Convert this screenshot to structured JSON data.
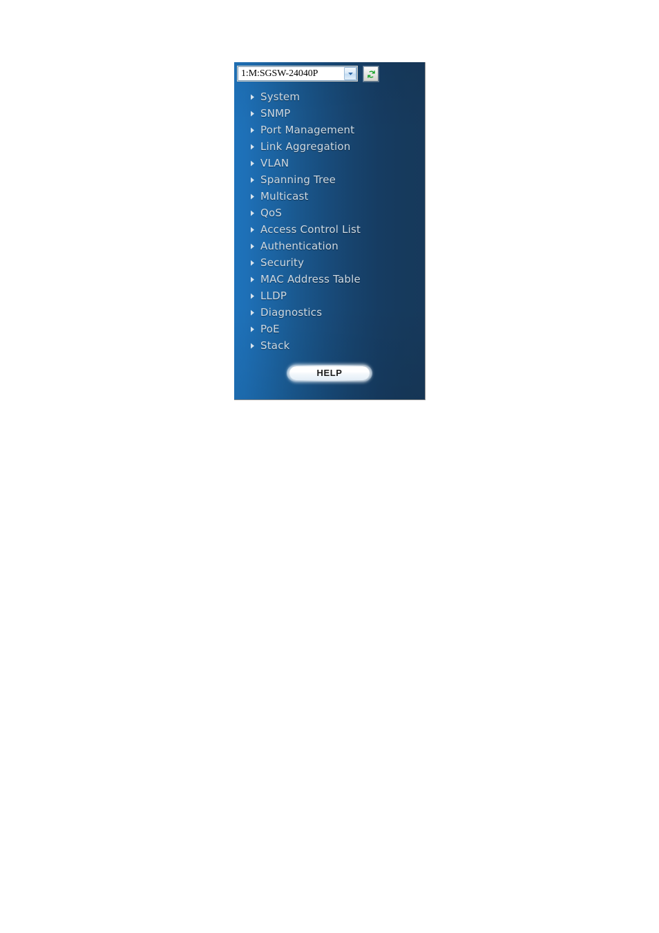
{
  "panel": {
    "name": "switch-navigation-panel",
    "background_left_color": "#1f73bb",
    "background_right_color": "#17395b"
  },
  "device_selector": {
    "selected_value": "1:M:SGSW-24040P",
    "options": [
      "1:M:SGSW-24040P"
    ],
    "chevron_icon": "chevron-down-icon"
  },
  "refresh_button": {
    "icon": "refresh-icon",
    "icon_color": "#14a026",
    "title": "Refresh"
  },
  "menu": {
    "bullet_icon": "triangle-right-icon",
    "text_color": "#cfdae3",
    "items": [
      {
        "label": "System"
      },
      {
        "label": "SNMP"
      },
      {
        "label": "Port Management"
      },
      {
        "label": "Link Aggregation"
      },
      {
        "label": "VLAN"
      },
      {
        "label": "Spanning Tree"
      },
      {
        "label": "Multicast"
      },
      {
        "label": "QoS"
      },
      {
        "label": "Access Control List"
      },
      {
        "label": "Authentication"
      },
      {
        "label": "Security"
      },
      {
        "label": "MAC Address Table"
      },
      {
        "label": "LLDP"
      },
      {
        "label": "Diagnostics"
      },
      {
        "label": "PoE"
      },
      {
        "label": "Stack"
      }
    ]
  },
  "help_button": {
    "label": "HELP"
  }
}
